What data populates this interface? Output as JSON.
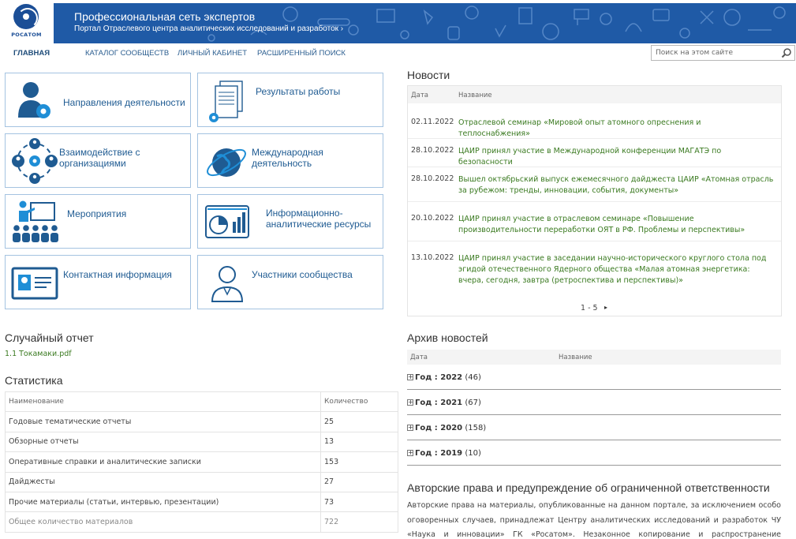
{
  "header": {
    "logo_text": "РОСАТОМ",
    "site_title": "Профессиональная сеть экспертов",
    "site_subtitle": "Портал Отраслевого центра аналитических исследований и разработок ›",
    "accent_color": "#1f5aa6"
  },
  "nav": {
    "items": [
      {
        "label": "ГЛАВНАЯ"
      },
      {
        "label": "КАТАЛОГ СООБЩЕСТВ"
      },
      {
        "label": "ЛИЧНЫЙ КАБИНЕТ"
      },
      {
        "label": "РАСШИРЕННЫЙ ПОИСК"
      }
    ],
    "search_placeholder": "Поиск на этом сайте",
    "search_icon": "magnifier-icon"
  },
  "tiles": [
    {
      "label": "Направления деятельности",
      "icon": "person-gear-icon"
    },
    {
      "label": "Результаты работы",
      "icon": "documents-gear-icon"
    },
    {
      "label": "Взаимодействие с организациями",
      "icon": "people-network-icon"
    },
    {
      "label": "Международная деятельность",
      "icon": "globe-orbit-icon"
    },
    {
      "label": "Мероприятия",
      "icon": "presentation-audience-icon"
    },
    {
      "label": "Информационно-аналитические ресурсы",
      "icon": "analytics-chart-icon"
    },
    {
      "label": "Контактная информация",
      "icon": "contact-card-icon"
    },
    {
      "label": "Участники сообщества",
      "icon": "person-outline-icon"
    }
  ],
  "news": {
    "heading": "Новости",
    "col_date": "Дата",
    "col_title": "Название",
    "items": [
      {
        "date": "02.11.2022",
        "title": "Отраслевой семинар «Мировой опыт атомного опреснения и теплоснабжения»"
      },
      {
        "date": "28.10.2022",
        "title": "ЦАИР принял участие в Международной конференции МАГАТЭ по безопасности"
      },
      {
        "date": "28.10.2022",
        "title": "Вышел октябрьский выпуск ежемесячного дайджеста ЦАИР «Атомная отрасль за рубежом: тренды, инновации, события, документы»"
      },
      {
        "date": "20.10.2022",
        "title": "ЦАИР принял участие в отраслевом семинаре «Повышение производительности переработки ОЯТ в РФ. Проблемы и перспективы»"
      },
      {
        "date": "13.10.2022",
        "title": "ЦАИР принял участие в заседании научно-исторического круглого стола под эгидой отечественного Ядерного общества «Малая атомная энергетика: вчера, сегодня, завтра (ретроспектива и перспективы)»"
      }
    ],
    "pager": "1 - 5",
    "pager_next": "▸"
  },
  "random_report": {
    "heading": "Случайный отчет",
    "link": "1.1 Токамаки.pdf"
  },
  "stats": {
    "heading": "Статистика",
    "col_name": "Наименование",
    "col_count": "Количество",
    "rows": [
      {
        "name": "Годовые тематические отчеты",
        "count": "25"
      },
      {
        "name": "Обзорные отчеты",
        "count": "13"
      },
      {
        "name": "Оперативные справки и аналитические записки",
        "count": "153"
      },
      {
        "name": "Дайджесты",
        "count": "27"
      },
      {
        "name": "Прочие материалы (статьи, интервью, презентации)",
        "count": "73"
      },
      {
        "name": "Общее количество материалов",
        "count": "722"
      }
    ]
  },
  "archive": {
    "heading": "Архив новостей",
    "col_date": "Дата",
    "col_title": "Название",
    "years": [
      {
        "label": "Год : 2022",
        "count": "(46)"
      },
      {
        "label": "Год : 2021",
        "count": "(67)"
      },
      {
        "label": "Год : 2020",
        "count": "(158)"
      },
      {
        "label": "Год : 2019",
        "count": "(10)"
      }
    ]
  },
  "copyright": {
    "heading": "Авторские права и предупреждение об ограниченной ответственности",
    "text": "Авторские права на материалы, опубликованные на данном портале, за исключением особо оговоренных случаев, принадлежат Центру аналитических исследований и разработок ЧУ «Наука и инновации» ГК «Росатом». Незаконное копирование и распространение информации,"
  }
}
